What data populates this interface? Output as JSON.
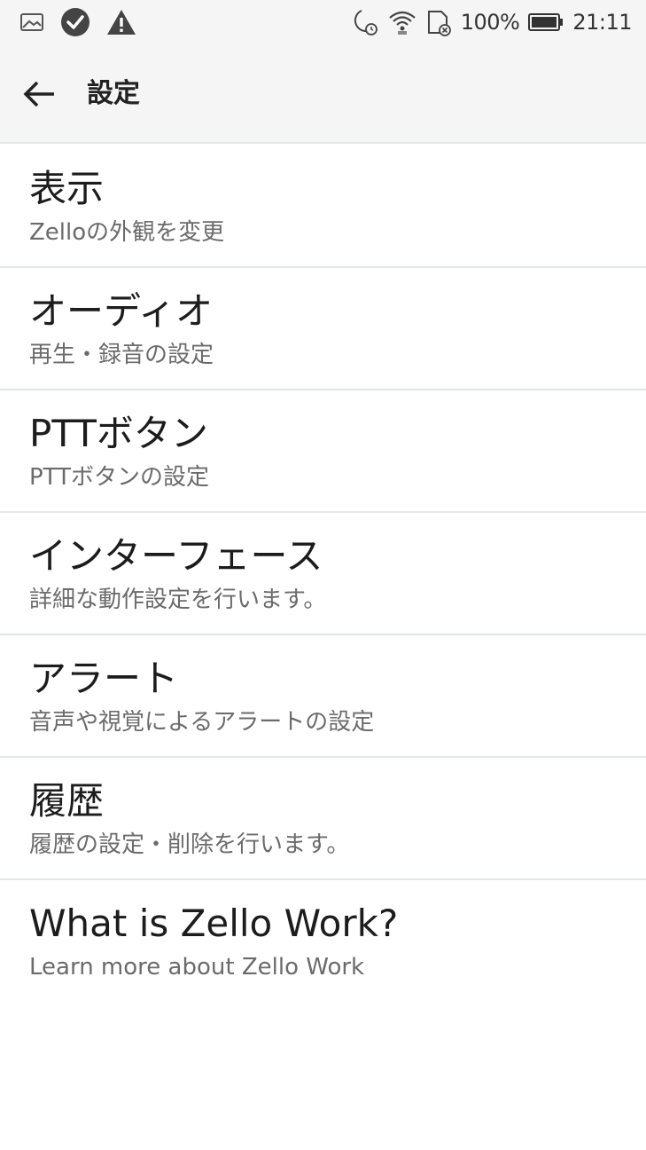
{
  "status_bar": {
    "left_icons": [
      "image-icon",
      "check-circle-icon",
      "warning-icon"
    ],
    "right_icons": [
      "moon-alarm-icon",
      "wifi-icon",
      "sd-card-icon",
      "battery-icon"
    ],
    "battery_percent": "100%",
    "time": "21:11"
  },
  "app_bar": {
    "back_icon": "arrow-back-icon",
    "title": "設定"
  },
  "settings": {
    "items": [
      {
        "title": "表示",
        "subtitle": "Zelloの外観を変更"
      },
      {
        "title": "オーディオ",
        "subtitle": "再生・録音の設定"
      },
      {
        "title": "PTTボタン",
        "subtitle": "PTTボタンの設定"
      },
      {
        "title": "インターフェース",
        "subtitle": "詳細な動作設定を行います。"
      },
      {
        "title": "アラート",
        "subtitle": "音声や視覚によるアラートの設定"
      },
      {
        "title": "履歴",
        "subtitle": "履歴の設定・削除を行います。"
      },
      {
        "title": "What is Zello Work?",
        "subtitle": "Learn more about Zello Work"
      }
    ]
  },
  "colors": {
    "bar_background": "#f5f5f5",
    "divider": "#e2e8e8",
    "title_text": "#1c1c1c",
    "subtitle_text": "#6b6b6b"
  }
}
